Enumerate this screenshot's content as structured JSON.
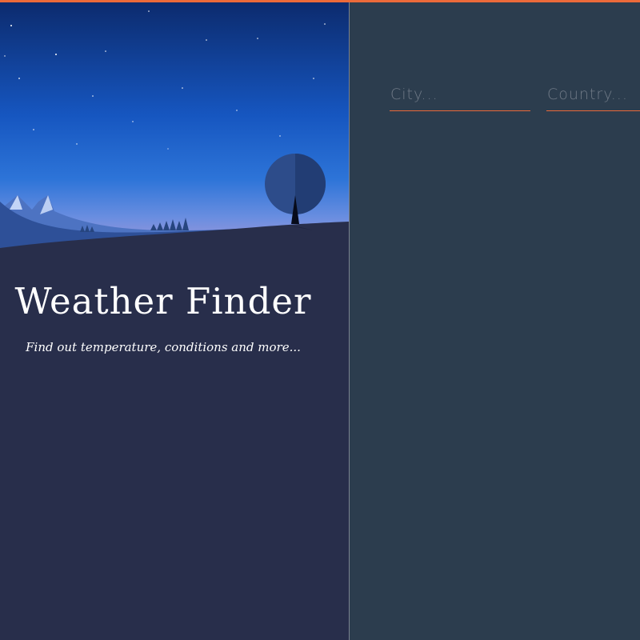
{
  "colors": {
    "accent": "#ec6a3a",
    "left_panel_bg": "#282e4b",
    "right_panel_bg": "#2c3d4e",
    "sky_top": "#0d2b6f",
    "sky_bottom": "#9a8fd8"
  },
  "hero": {
    "title": "Weather Finder",
    "subtitle": "Find out temperature, conditions and more..."
  },
  "form": {
    "city_placeholder": "City...",
    "country_placeholder": "Country..."
  },
  "illustration": {
    "elements": [
      "night-sky",
      "stars",
      "mountains",
      "pine-trees",
      "round-tree",
      "hill"
    ]
  }
}
